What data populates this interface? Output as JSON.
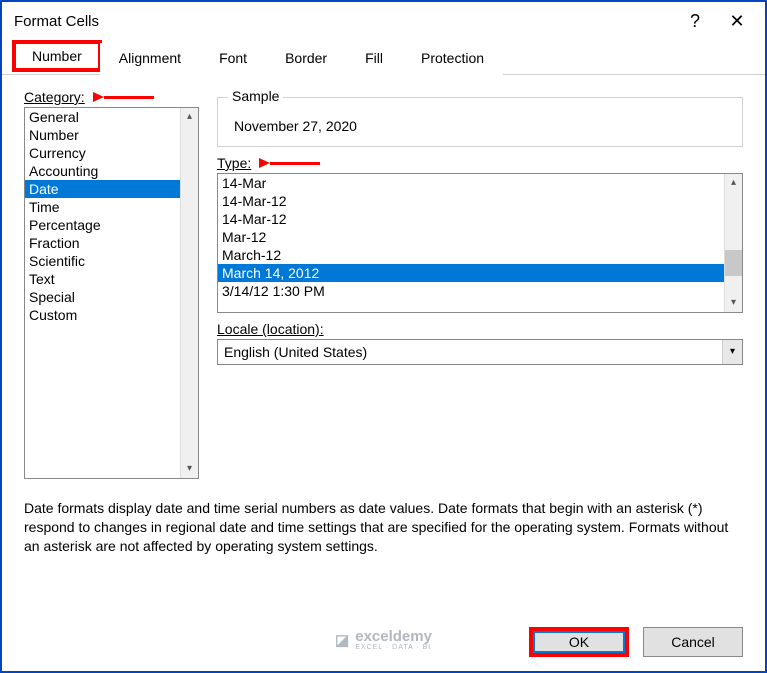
{
  "title": "Format Cells",
  "tabs": [
    "Number",
    "Alignment",
    "Font",
    "Border",
    "Fill",
    "Protection"
  ],
  "active_tab": 0,
  "category_label": "Category:",
  "categories": [
    "General",
    "Number",
    "Currency",
    "Accounting",
    "Date",
    "Time",
    "Percentage",
    "Fraction",
    "Scientific",
    "Text",
    "Special",
    "Custom"
  ],
  "category_selected": 4,
  "sample_label": "Sample",
  "sample_value": "November 27, 2020",
  "type_label": "Type:",
  "types": [
    "14-Mar",
    "14-Mar-12",
    "14-Mar-12",
    "Mar-12",
    "March-12",
    "March 14, 2012",
    "3/14/12 1:30 PM"
  ],
  "type_selected": 5,
  "locale_label": "Locale (location):",
  "locale_value": "English (United States)",
  "description": "Date formats display date and time serial numbers as date values.  Date formats that begin with an asterisk (*) respond to changes in regional date and time settings that are specified for the operating system. Formats without an asterisk are not affected by operating system settings.",
  "buttons": {
    "ok": "OK",
    "cancel": "Cancel"
  },
  "watermark": {
    "name": "exceldemy",
    "sub": "EXCEL · DATA · BI"
  }
}
